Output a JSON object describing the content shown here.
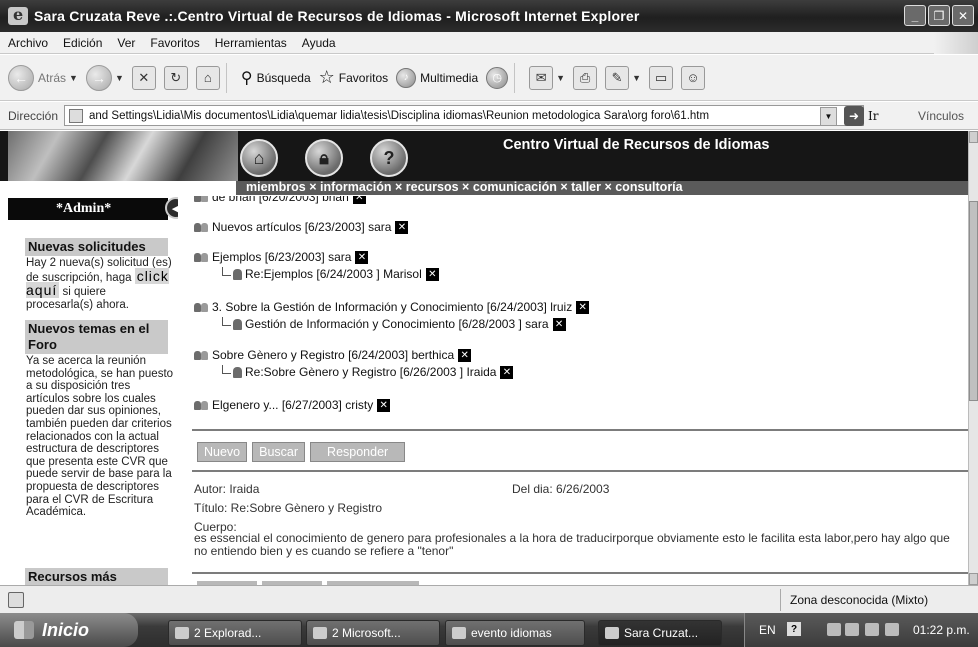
{
  "window": {
    "title": "Sara Cruzata Reve .:.Centro Virtual de Recursos de Idiomas - Microsoft Internet Explorer"
  },
  "menu": [
    "Archivo",
    "Edición",
    "Ver",
    "Favoritos",
    "Herramientas",
    "Ayuda"
  ],
  "toolbar": {
    "back": "Atrás",
    "search": "Búsqueda",
    "favorites": "Favoritos",
    "multimedia": "Multimedia"
  },
  "address": {
    "label": "Dirección",
    "value": "and Settings\\Lidia\\Mis documentos\\Lidia\\quemar lidia\\tesis\\Disciplina idiomas\\Reunion metodologica Sara\\org foro\\61.htm",
    "go": "Ir",
    "links": "Vínculos"
  },
  "site": {
    "title": "Centro Virtual de Recursos de Idiomas",
    "nav": "miembros × información × recursos × comunicación × taller × consultoría"
  },
  "sidebar": {
    "admin": "*Admin*",
    "new_requests_title": "Nuevas solicitudes",
    "new_requests_text_1": "Hay 2 nueva(s) solicitud (es) de suscripción, haga",
    "click_here": "click aquí",
    "new_requests_text_2": "si quiere procesarla(s) ahora.",
    "forum_title": "Nuevos temas en el Foro",
    "forum_text": "Ya se acerca la reunión metodológica, se han puesto a su disposición tres artículos sobre los cuales pueden dar sus opiniones, también pueden dar criterios relacionados con la actual estructura de descriptores que presenta este CVR que puede servir de base para la propuesta de descriptores para el CVR de Escritura Académica.",
    "resources_title": "Recursos más"
  },
  "forum": {
    "cut_entry": "de brian [6/20/2003] brian",
    "entries": [
      {
        "text": "Nuevos artículos [6/23/2003] sara",
        "reply": false
      },
      {
        "text": "Ejemplos [6/23/2003] sara",
        "reply": false
      },
      {
        "text": "Re:Ejemplos [6/24/2003 ] Marisol",
        "reply": true
      },
      {
        "text": "3. Sobre la Gestión de Información y Conocimiento [6/24/2003] lruiz",
        "reply": false
      },
      {
        "text": "Gestión de Información y Conocimiento [6/28/2003 ] sara",
        "reply": true
      },
      {
        "text": "Sobre Gènero y Registro [6/24/2003] berthica",
        "reply": false
      },
      {
        "text": "Re:Sobre Gènero y Registro [6/26/2003 ] Iraida",
        "reply": true
      },
      {
        "text": "Elgenero y... [6/27/2003] cristy",
        "reply": false
      }
    ],
    "delete_symbol": "✕",
    "buttons": {
      "new": "Nuevo",
      "search": "Buscar",
      "reply": "Responder"
    }
  },
  "message": {
    "author": "Autor: Iraida",
    "date": "Del dia: 6/26/2003",
    "title": "Título: Re:Sobre Gènero y Registro",
    "body_label": "Cuerpo:",
    "body": "es essencial el conocimiento de genero para profesionales a la hora de traducirporque obviamente esto le facilita esta labor,pero hay algo que no entiendo bien y es cuando se refiere a \"tenor\""
  },
  "status": {
    "zone": "Zona desconocida (Mixto)"
  },
  "taskbar": {
    "start": "Inicio",
    "items": [
      "2 Explorad...",
      "2 Microsoft...",
      "evento idiomas",
      "Sara Cruzat..."
    ],
    "lang": "EN",
    "clock": "01:22 p.m."
  }
}
